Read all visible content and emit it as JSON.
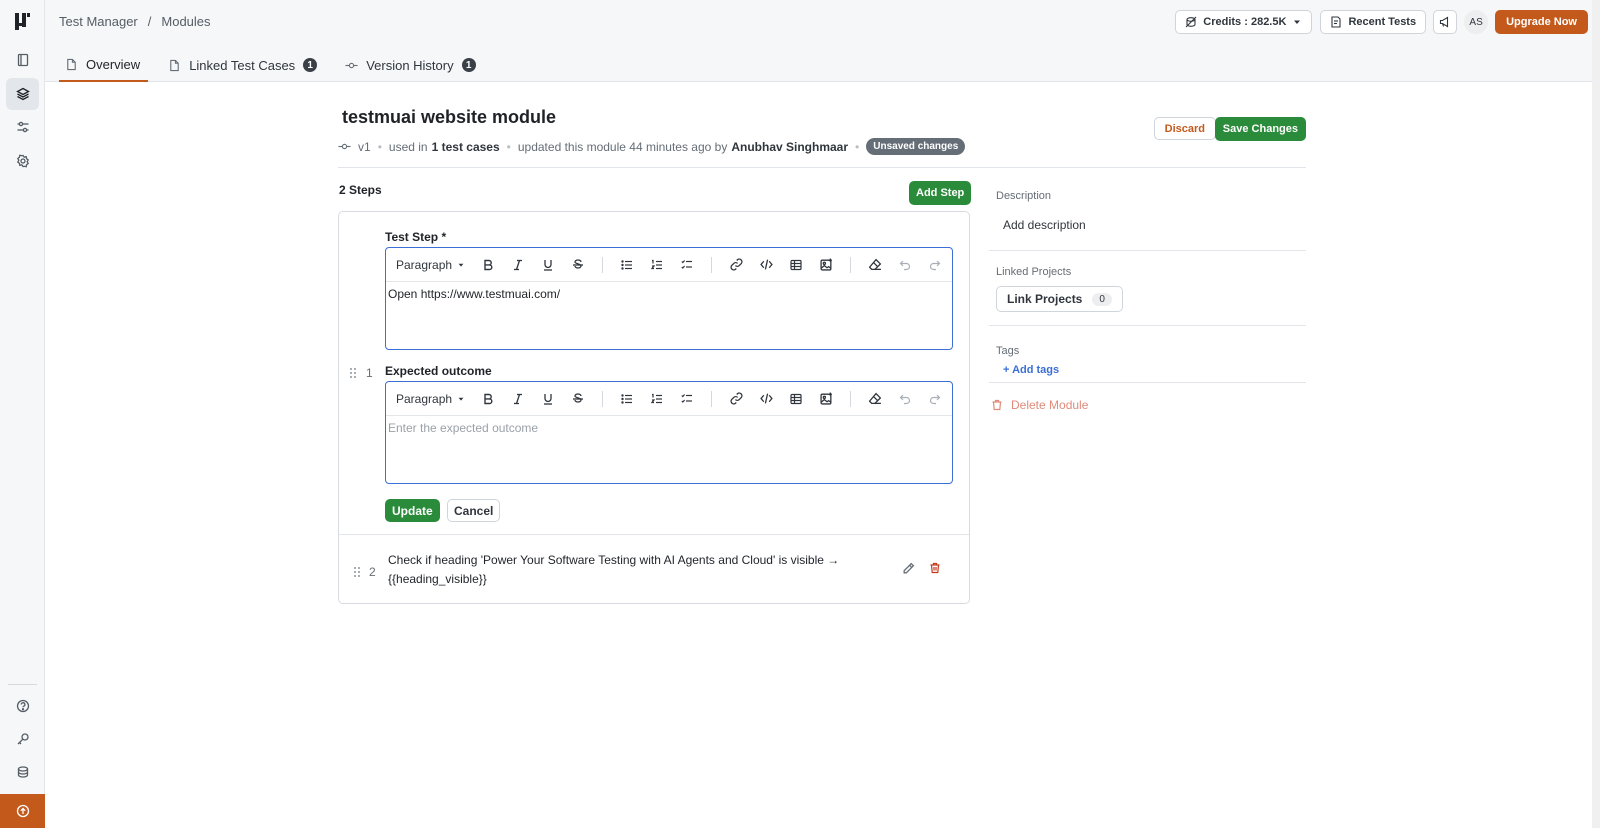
{
  "nav": {
    "items": [
      "home",
      "modules",
      "configurations",
      "settings",
      "help",
      "key",
      "billing",
      "upgrade"
    ]
  },
  "breadcrumb": {
    "root": "Test Manager",
    "separator": "/",
    "current": "Modules"
  },
  "tabs": [
    {
      "label": "Overview"
    },
    {
      "label": "Linked Test Cases",
      "count": "1"
    },
    {
      "label": "Version History",
      "count": "1"
    }
  ],
  "topright": {
    "credits": "Credits : 282.5K",
    "recent_tests": "Recent Tests",
    "avatar": "AS",
    "upgrade": "Upgrade Now"
  },
  "module": {
    "title": "testmuai website module",
    "version": "v1",
    "used_prefix": "used in",
    "used_count": "1 test cases",
    "updated": "updated this module 44 minutes ago by",
    "author": "Anubhav Singhmaar",
    "badge": "Unsaved changes",
    "discard": "Discard",
    "save": "Save Changes"
  },
  "steps": {
    "count_label": "2 Steps",
    "add_step": "Add Step",
    "step1": {
      "number": "1",
      "test_step_label": "Test Step *",
      "test_step_value": "Open https://www.testmuai.com/",
      "expected_label": "Expected outcome",
      "expected_placeholder": "Enter the expected outcome",
      "paragraph": "Paragraph",
      "update": "Update",
      "cancel": "Cancel"
    },
    "step2": {
      "number": "2",
      "text": "Check if heading 'Power Your Software Testing with AI Agents and Cloud' is visible → {{heading_visible}}"
    }
  },
  "sidebar": {
    "description_label": "Description",
    "description_value": "Add description",
    "linked_projects_label": "Linked Projects",
    "link_projects": "Link Projects",
    "link_projects_count": "0",
    "tags_label": "Tags",
    "add_tags": "+ Add tags",
    "delete_module": "Delete Module"
  },
  "colors": {
    "accent": "#c4591c",
    "primary_green": "#2a8c3a",
    "focus_blue": "#3b6fd6"
  }
}
